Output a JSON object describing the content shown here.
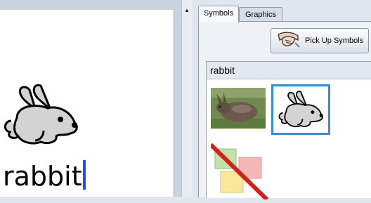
{
  "document": {
    "word": "rabbit",
    "symbol_icon": "rabbit-symbol-icon"
  },
  "scrollbar": {
    "up_arrow": "▲"
  },
  "panel": {
    "tabs": [
      {
        "label": "Symbols",
        "active": true
      },
      {
        "label": "Graphics",
        "active": false
      }
    ],
    "pickup_button": {
      "label": "Pick Up Symbols",
      "icon": "hand-pickup-icon"
    },
    "search_text": "rabbit",
    "results": [
      {
        "kind": "photo",
        "name": "rabbit-photo"
      },
      {
        "kind": "symbol",
        "name": "rabbit-symbol",
        "selected": true
      },
      {
        "kind": "no-symbol",
        "name": "no-symbol-icon"
      }
    ]
  },
  "colors": {
    "selection_border": "#2f8fe8",
    "caret": "#2b4de0",
    "no_symbol_slash": "#d4211c"
  }
}
